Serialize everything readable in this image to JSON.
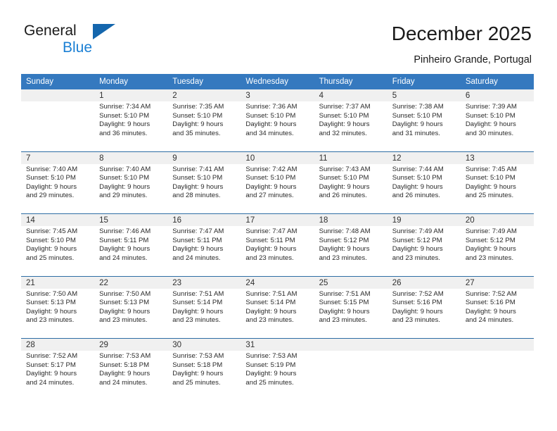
{
  "brand": {
    "name_line1": "General",
    "name_line2": "Blue",
    "accent_color": "#1a7fd4",
    "triangle_color": "#1466ad"
  },
  "header": {
    "title": "December 2025",
    "location": "Pinheiro Grande, Portugal"
  },
  "calendar": {
    "header_bg": "#3579bf",
    "daynum_bg": "#f0f0f0",
    "rule_color": "#2e6da4",
    "weekday_headers": [
      "Sunday",
      "Monday",
      "Tuesday",
      "Wednesday",
      "Thursday",
      "Friday",
      "Saturday"
    ],
    "weeks": [
      [
        {
          "day": ""
        },
        {
          "day": "1",
          "sunrise": "Sunrise: 7:34 AM",
          "sunset": "Sunset: 5:10 PM",
          "daylight1": "Daylight: 9 hours",
          "daylight2": "and 36 minutes."
        },
        {
          "day": "2",
          "sunrise": "Sunrise: 7:35 AM",
          "sunset": "Sunset: 5:10 PM",
          "daylight1": "Daylight: 9 hours",
          "daylight2": "and 35 minutes."
        },
        {
          "day": "3",
          "sunrise": "Sunrise: 7:36 AM",
          "sunset": "Sunset: 5:10 PM",
          "daylight1": "Daylight: 9 hours",
          "daylight2": "and 34 minutes."
        },
        {
          "day": "4",
          "sunrise": "Sunrise: 7:37 AM",
          "sunset": "Sunset: 5:10 PM",
          "daylight1": "Daylight: 9 hours",
          "daylight2": "and 32 minutes."
        },
        {
          "day": "5",
          "sunrise": "Sunrise: 7:38 AM",
          "sunset": "Sunset: 5:10 PM",
          "daylight1": "Daylight: 9 hours",
          "daylight2": "and 31 minutes."
        },
        {
          "day": "6",
          "sunrise": "Sunrise: 7:39 AM",
          "sunset": "Sunset: 5:10 PM",
          "daylight1": "Daylight: 9 hours",
          "daylight2": "and 30 minutes."
        }
      ],
      [
        {
          "day": "7",
          "sunrise": "Sunrise: 7:40 AM",
          "sunset": "Sunset: 5:10 PM",
          "daylight1": "Daylight: 9 hours",
          "daylight2": "and 29 minutes."
        },
        {
          "day": "8",
          "sunrise": "Sunrise: 7:40 AM",
          "sunset": "Sunset: 5:10 PM",
          "daylight1": "Daylight: 9 hours",
          "daylight2": "and 29 minutes."
        },
        {
          "day": "9",
          "sunrise": "Sunrise: 7:41 AM",
          "sunset": "Sunset: 5:10 PM",
          "daylight1": "Daylight: 9 hours",
          "daylight2": "and 28 minutes."
        },
        {
          "day": "10",
          "sunrise": "Sunrise: 7:42 AM",
          "sunset": "Sunset: 5:10 PM",
          "daylight1": "Daylight: 9 hours",
          "daylight2": "and 27 minutes."
        },
        {
          "day": "11",
          "sunrise": "Sunrise: 7:43 AM",
          "sunset": "Sunset: 5:10 PM",
          "daylight1": "Daylight: 9 hours",
          "daylight2": "and 26 minutes."
        },
        {
          "day": "12",
          "sunrise": "Sunrise: 7:44 AM",
          "sunset": "Sunset: 5:10 PM",
          "daylight1": "Daylight: 9 hours",
          "daylight2": "and 26 minutes."
        },
        {
          "day": "13",
          "sunrise": "Sunrise: 7:45 AM",
          "sunset": "Sunset: 5:10 PM",
          "daylight1": "Daylight: 9 hours",
          "daylight2": "and 25 minutes."
        }
      ],
      [
        {
          "day": "14",
          "sunrise": "Sunrise: 7:45 AM",
          "sunset": "Sunset: 5:10 PM",
          "daylight1": "Daylight: 9 hours",
          "daylight2": "and 25 minutes."
        },
        {
          "day": "15",
          "sunrise": "Sunrise: 7:46 AM",
          "sunset": "Sunset: 5:11 PM",
          "daylight1": "Daylight: 9 hours",
          "daylight2": "and 24 minutes."
        },
        {
          "day": "16",
          "sunrise": "Sunrise: 7:47 AM",
          "sunset": "Sunset: 5:11 PM",
          "daylight1": "Daylight: 9 hours",
          "daylight2": "and 24 minutes."
        },
        {
          "day": "17",
          "sunrise": "Sunrise: 7:47 AM",
          "sunset": "Sunset: 5:11 PM",
          "daylight1": "Daylight: 9 hours",
          "daylight2": "and 23 minutes."
        },
        {
          "day": "18",
          "sunrise": "Sunrise: 7:48 AM",
          "sunset": "Sunset: 5:12 PM",
          "daylight1": "Daylight: 9 hours",
          "daylight2": "and 23 minutes."
        },
        {
          "day": "19",
          "sunrise": "Sunrise: 7:49 AM",
          "sunset": "Sunset: 5:12 PM",
          "daylight1": "Daylight: 9 hours",
          "daylight2": "and 23 minutes."
        },
        {
          "day": "20",
          "sunrise": "Sunrise: 7:49 AM",
          "sunset": "Sunset: 5:12 PM",
          "daylight1": "Daylight: 9 hours",
          "daylight2": "and 23 minutes."
        }
      ],
      [
        {
          "day": "21",
          "sunrise": "Sunrise: 7:50 AM",
          "sunset": "Sunset: 5:13 PM",
          "daylight1": "Daylight: 9 hours",
          "daylight2": "and 23 minutes."
        },
        {
          "day": "22",
          "sunrise": "Sunrise: 7:50 AM",
          "sunset": "Sunset: 5:13 PM",
          "daylight1": "Daylight: 9 hours",
          "daylight2": "and 23 minutes."
        },
        {
          "day": "23",
          "sunrise": "Sunrise: 7:51 AM",
          "sunset": "Sunset: 5:14 PM",
          "daylight1": "Daylight: 9 hours",
          "daylight2": "and 23 minutes."
        },
        {
          "day": "24",
          "sunrise": "Sunrise: 7:51 AM",
          "sunset": "Sunset: 5:14 PM",
          "daylight1": "Daylight: 9 hours",
          "daylight2": "and 23 minutes."
        },
        {
          "day": "25",
          "sunrise": "Sunrise: 7:51 AM",
          "sunset": "Sunset: 5:15 PM",
          "daylight1": "Daylight: 9 hours",
          "daylight2": "and 23 minutes."
        },
        {
          "day": "26",
          "sunrise": "Sunrise: 7:52 AM",
          "sunset": "Sunset: 5:16 PM",
          "daylight1": "Daylight: 9 hours",
          "daylight2": "and 23 minutes."
        },
        {
          "day": "27",
          "sunrise": "Sunrise: 7:52 AM",
          "sunset": "Sunset: 5:16 PM",
          "daylight1": "Daylight: 9 hours",
          "daylight2": "and 24 minutes."
        }
      ],
      [
        {
          "day": "28",
          "sunrise": "Sunrise: 7:52 AM",
          "sunset": "Sunset: 5:17 PM",
          "daylight1": "Daylight: 9 hours",
          "daylight2": "and 24 minutes."
        },
        {
          "day": "29",
          "sunrise": "Sunrise: 7:53 AM",
          "sunset": "Sunset: 5:18 PM",
          "daylight1": "Daylight: 9 hours",
          "daylight2": "and 24 minutes."
        },
        {
          "day": "30",
          "sunrise": "Sunrise: 7:53 AM",
          "sunset": "Sunset: 5:18 PM",
          "daylight1": "Daylight: 9 hours",
          "daylight2": "and 25 minutes."
        },
        {
          "day": "31",
          "sunrise": "Sunrise: 7:53 AM",
          "sunset": "Sunset: 5:19 PM",
          "daylight1": "Daylight: 9 hours",
          "daylight2": "and 25 minutes."
        },
        {
          "day": ""
        },
        {
          "day": ""
        },
        {
          "day": ""
        }
      ]
    ]
  }
}
